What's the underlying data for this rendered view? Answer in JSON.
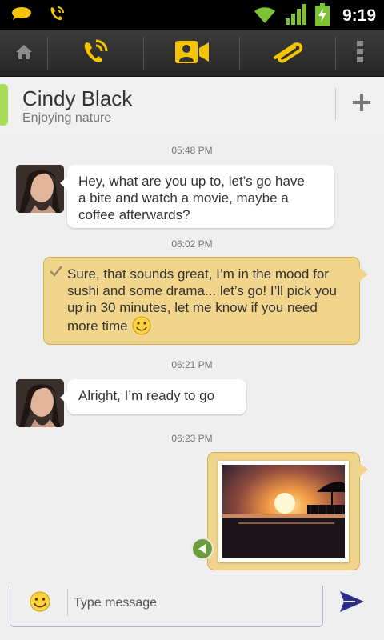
{
  "status_bar": {
    "time": "9:19",
    "icons": [
      "chat-bubble-icon",
      "incoming-call-icon",
      "wifi-icon",
      "signal-icon",
      "battery-charging-icon"
    ]
  },
  "toolbar": {
    "icons": [
      "home-icon",
      "voice-call-icon",
      "video-call-icon",
      "attachment-icon",
      "overflow-menu-icon"
    ],
    "accent_color": "#f5c400"
  },
  "contact": {
    "name": "Cindy Black",
    "status": "Enjoying nature",
    "presence_color": "#a8dd5c"
  },
  "messages": [
    {
      "time": "05:48 PM",
      "direction": "incoming",
      "lines": [
        "Hey, what are you up to, let’s go have",
        "a bite and watch a movie, maybe a",
        "coffee afterwards?"
      ]
    },
    {
      "time": "06:02 PM",
      "direction": "outgoing",
      "lines": [
        "Sure, that sounds great, I’m in the mood for",
        "sushi and some drama... let’s go! I’ll pick you",
        "up in 30 minutes, let me know if you need",
        "more time"
      ],
      "emoji": "smiley-icon"
    },
    {
      "time": "06:21 PM",
      "direction": "incoming",
      "lines": [
        "Alright, I’m ready to go"
      ]
    },
    {
      "time": "06:23 PM",
      "direction": "outgoing",
      "attachment": "sunset-photo"
    }
  ],
  "composer": {
    "placeholder": "Type message",
    "emoji_icon": "smiley-icon",
    "send_icon": "send-icon"
  },
  "colors": {
    "outgoing_bubble": "#f1d58c",
    "incoming_bubble": "#ffffff",
    "send": "#2d2d8c"
  }
}
